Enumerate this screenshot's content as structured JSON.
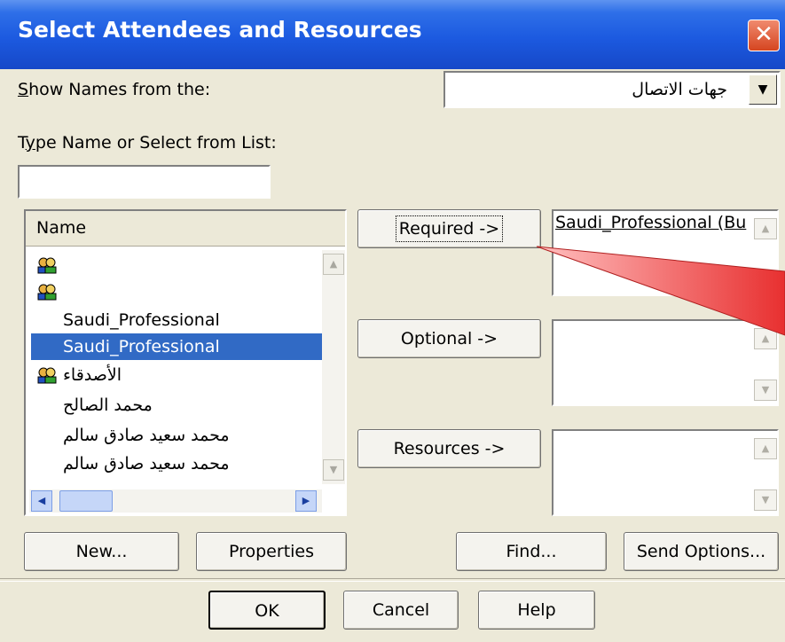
{
  "window": {
    "title": "Select Attendees and Resources",
    "close_icon": "close-icon"
  },
  "show_names": {
    "label": "Show Names from the:",
    "value": "جهات الاتصال"
  },
  "type_name": {
    "label": "Type Name or Select from List:",
    "value": ""
  },
  "list": {
    "header": "Name",
    "rows": [
      {
        "text": "",
        "icon": "contact-group-icon",
        "selected": false
      },
      {
        "text": "",
        "icon": "contact-group-icon",
        "selected": false
      },
      {
        "text": "Saudi_Professional",
        "icon": "",
        "selected": false
      },
      {
        "text": "Saudi_Professional",
        "icon": "",
        "selected": true
      },
      {
        "text": "الأصدقاء",
        "icon": "contact-group-icon",
        "selected": false
      },
      {
        "text": "محمد الصالح",
        "icon": "",
        "selected": false
      },
      {
        "text": "محمد سعيد صادق سالم",
        "icon": "",
        "selected": false
      },
      {
        "text": "محمد سعيد صادق سالم",
        "icon": "",
        "selected": false
      }
    ]
  },
  "recipients": {
    "required_label": "Required ->",
    "required_value": "Saudi_Professional (Bu",
    "optional_label": "Optional ->",
    "resources_label": "Resources ->"
  },
  "buttons": {
    "new": "New...",
    "properties": "Properties",
    "find": "Find...",
    "send_options": "Send Options...",
    "ok": "OK",
    "cancel": "Cancel",
    "help": "Help"
  },
  "colors": {
    "title_bar": "#1c5ae0",
    "selection": "#316ac5",
    "face": "#ece9d8",
    "callout": "#e83030"
  }
}
